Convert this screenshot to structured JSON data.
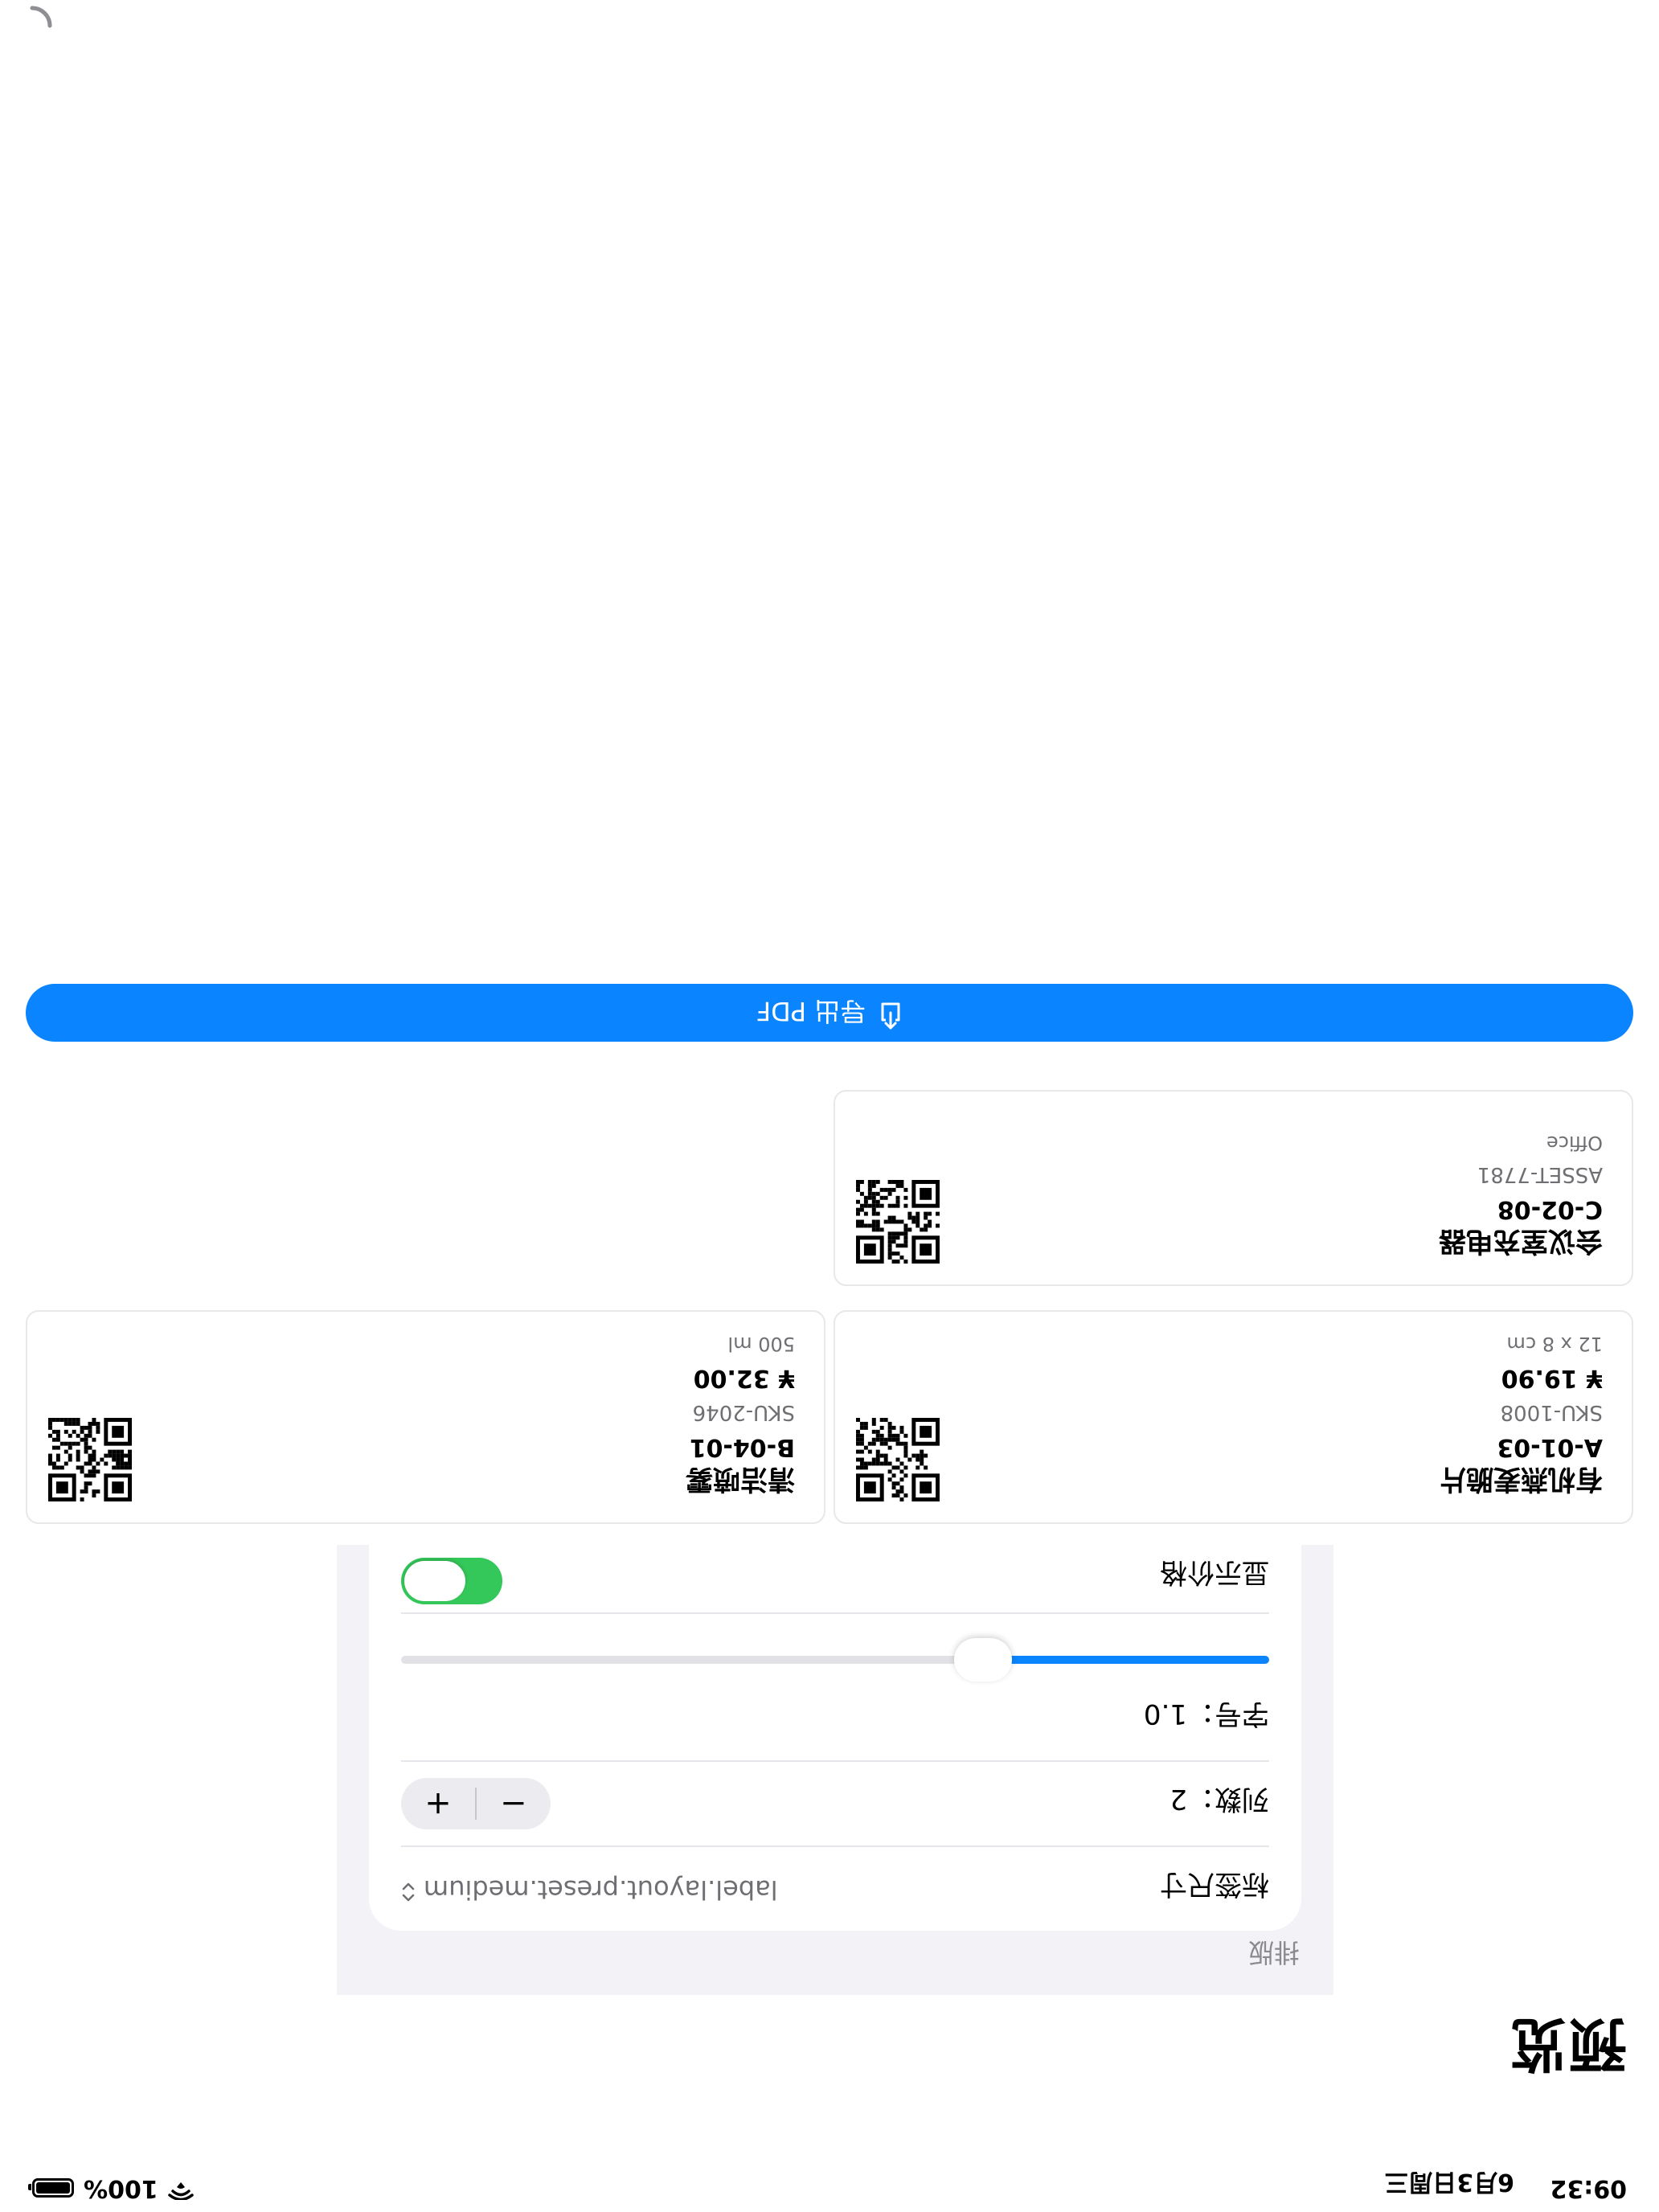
{
  "status_bar": {
    "time": "09:32",
    "date": "6月3日周三",
    "battery": "100%",
    "battery_level": 1.0
  },
  "page": {
    "title": "预览"
  },
  "layout_section": {
    "header": "排版",
    "label_size": {
      "label": "标签尺寸",
      "value": "label.layout.preset.medium"
    },
    "columns": {
      "label": "列数：2",
      "value": 2
    },
    "font_size": {
      "label": "字号：1.0",
      "value": 1.0,
      "slider_fraction": 0.33
    },
    "show_price": {
      "label": "显示价格",
      "on": true
    }
  },
  "labels": [
    {
      "title": "有机燕麦脆片",
      "code": "A-01-03",
      "sku": "SKU-1008",
      "price": "¥ 19.90",
      "size": "12 x 8 cm"
    },
    {
      "title": "清洁喷雾",
      "code": "B-04-01",
      "sku": "SKU-2046",
      "price": "¥ 32.00",
      "size": "500 ml"
    },
    {
      "title": "会议室充电器",
      "code": "C-02-08",
      "sku": "ASSET-7781",
      "price": "",
      "size": "Office"
    }
  ],
  "export": {
    "label": "导出 PDF",
    "icon": "share-icon"
  },
  "colors": {
    "accent": "#0a84ff",
    "toggle_on": "#34c759",
    "panel_bg": "#f2f2f7"
  }
}
